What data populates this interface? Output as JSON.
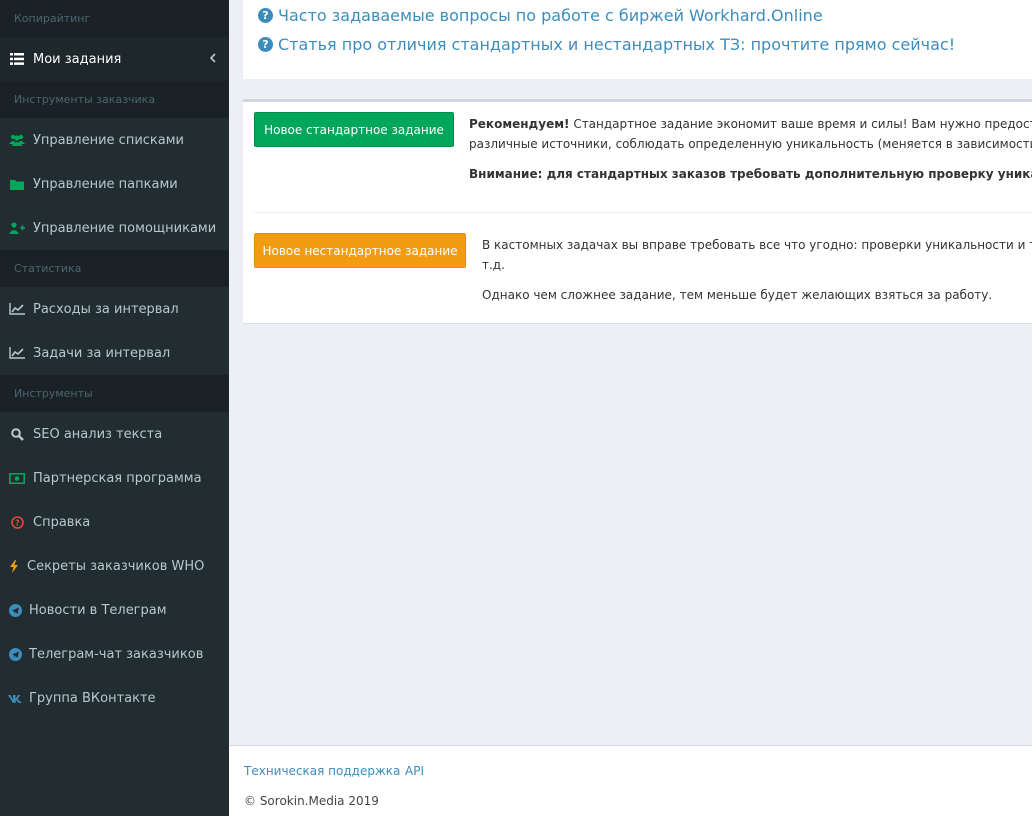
{
  "sidebar": {
    "sections": [
      {
        "header": "Копирайтинг"
      },
      {
        "header": "Инструменты заказчика"
      },
      {
        "header": "Статистика"
      },
      {
        "header": "Инструменты"
      }
    ],
    "items": {
      "my_tasks": {
        "label": "Мои задания",
        "icon": "list-icon"
      },
      "lists": {
        "label": "Управление списками",
        "icon": "users-icon"
      },
      "folders": {
        "label": "Управление папками",
        "icon": "folder-icon"
      },
      "helpers": {
        "label": "Управление помощниками",
        "icon": "user-plus-icon"
      },
      "expenses": {
        "label": "Расходы за интервал",
        "icon": "line-chart-icon"
      },
      "tasks_interval": {
        "label": "Задачи за интервал",
        "icon": "line-chart-icon"
      },
      "seo": {
        "label": "SEO анализ текста",
        "icon": "search-icon"
      },
      "partner": {
        "label": "Партнерская программа",
        "icon": "money-icon"
      },
      "help": {
        "label": "Справка",
        "icon": "life-ring-icon"
      },
      "secrets": {
        "label": "Секреты заказчиков WHO",
        "icon": "bolt-icon"
      },
      "tg_news": {
        "label": "Новости в Телеграм",
        "icon": "telegram-icon"
      },
      "tg_chat": {
        "label": "Телеграм-чат заказчиков",
        "icon": "telegram-icon"
      },
      "vk": {
        "label": "Группа ВКонтакте",
        "icon": "vk-icon"
      }
    }
  },
  "top_links": {
    "faq": "Часто задаваемые вопросы по работе с биржей Workhard.Online",
    "article": "Статья про отличия стандартных и нестандартных ТЗ: прочтите прямо сейчас!"
  },
  "standard": {
    "button": "Новое стандартное задание",
    "recommend_bold": "Рекомендуем!",
    "line1": " Стандартное задание экономит ваше время и силы! Вам нужно предоставить",
    "line2": "различные источники, соблюдать определенную уникальность (меняется в зависимости от т",
    "warning": "Внимание: для стандартных заказов требовать дополнительную проверку уникальности по"
  },
  "custom": {
    "button": "Новое нестандартное задание",
    "line1": "В кастомных задачах вы вправе требовать все что угодно: проверки уникальности и тошн",
    "line2": "т.д.",
    "line3": "Однако чем сложнее задание, тем меньше будет желающих взяться за работу."
  },
  "footer": {
    "support": "Техническая поддержка",
    "api": "API",
    "copyright": "© Sorokin.Media 2019"
  },
  "colors": {
    "sidebar_bg": "#222d32",
    "link": "#3c8dbc",
    "green": "#00a65a",
    "orange": "#f39c12"
  }
}
